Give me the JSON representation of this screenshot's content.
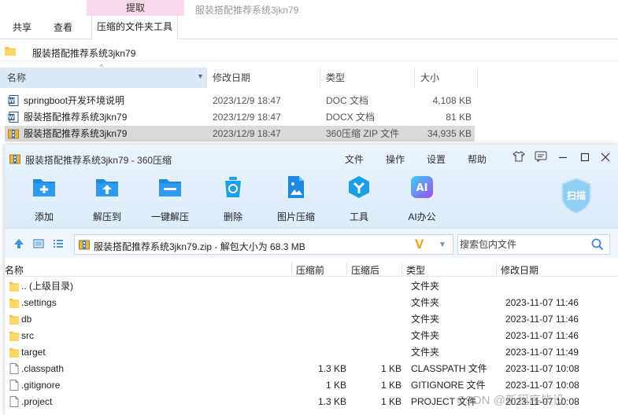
{
  "explorer": {
    "context_tab": "提取",
    "context_title": "服装搭配推荐系统3jkn79",
    "tabs": [
      "共享",
      "查看",
      "压缩的文件夹工具"
    ],
    "address": "服装搭配推荐系统3jkn79",
    "columns": {
      "name": "名称",
      "date": "修改日期",
      "type": "类型",
      "size": "大小"
    },
    "files": [
      {
        "name": "springboot开发环境说明",
        "date": "2023/12/9 18:47",
        "type": "DOC 文档",
        "size": "4,108 KB",
        "icon": "word-doc-icon"
      },
      {
        "name": "服装搭配推荐系统3jkn79",
        "date": "2023/12/9 18:47",
        "type": "DOCX 文档",
        "size": "81 KB",
        "icon": "word-docx-icon"
      },
      {
        "name": "服装搭配推荐系统3jkn79",
        "date": "2023/12/9 18:47",
        "type": "360压缩 ZIP 文件",
        "size": "34,935 KB",
        "icon": "zip-archive-icon"
      }
    ]
  },
  "zip": {
    "title": "服装搭配推荐系统3jkn79 - 360压缩",
    "menu": [
      "文件",
      "操作",
      "设置",
      "帮助"
    ],
    "tools": [
      {
        "label": "添加",
        "icon": "add-icon",
        "color": "#1e88e5"
      },
      {
        "label": "解压到",
        "icon": "extract-to-icon",
        "color": "#1e88e5"
      },
      {
        "label": "一键解压",
        "icon": "one-click-extract-icon",
        "color": "#1e88e5"
      },
      {
        "label": "删除",
        "icon": "delete-icon",
        "color": "#1aa0e8"
      },
      {
        "label": "图片压缩",
        "icon": "image-compress-icon",
        "color": "#1e88e5"
      },
      {
        "label": "工具",
        "icon": "tools-icon",
        "color": "#1aa0e8"
      },
      {
        "label": "AI办公",
        "icon": "ai-office-icon",
        "color": "#7b5cf0"
      }
    ],
    "scan_label": "扫描",
    "path": "服装搭配推荐系统3jkn79.zip - 解包大小为 68.3 MB",
    "path_badge": "V",
    "search_placeholder": "搜索包内文件",
    "columns": {
      "name": "名称",
      "before": "压缩前",
      "after": "压缩后",
      "type": "类型",
      "date": "修改日期"
    },
    "rows": [
      {
        "name": ".. (上级目录)",
        "before": "",
        "after": "",
        "type": "文件夹",
        "date": "",
        "icon": "folder-icon"
      },
      {
        "name": ".settings",
        "before": "",
        "after": "",
        "type": "文件夹",
        "date": "2023-11-07 11:46",
        "icon": "folder-icon"
      },
      {
        "name": "db",
        "before": "",
        "after": "",
        "type": "文件夹",
        "date": "2023-11-07 11:46",
        "icon": "folder-icon"
      },
      {
        "name": "src",
        "before": "",
        "after": "",
        "type": "文件夹",
        "date": "2023-11-07 11:46",
        "icon": "folder-icon"
      },
      {
        "name": "target",
        "before": "",
        "after": "",
        "type": "文件夹",
        "date": "2023-11-07 11:49",
        "icon": "folder-icon"
      },
      {
        "name": ".classpath",
        "before": "1.3 KB",
        "after": "1 KB",
        "type": "CLASSPATH 文件",
        "date": "2023-11-07 10:08",
        "icon": "file-icon"
      },
      {
        "name": ".gitignore",
        "before": "1 KB",
        "after": "1 KB",
        "type": "GITIGNORE 文件",
        "date": "2023-11-07 10:08",
        "icon": "file-icon"
      },
      {
        "name": ".project",
        "before": "1.3 KB",
        "after": "1 KB",
        "type": "PROJECT 文件",
        "date": "2023-11-07 10:08",
        "icon": "file-icon"
      }
    ]
  },
  "watermark": "CSDN @新程序毕设"
}
